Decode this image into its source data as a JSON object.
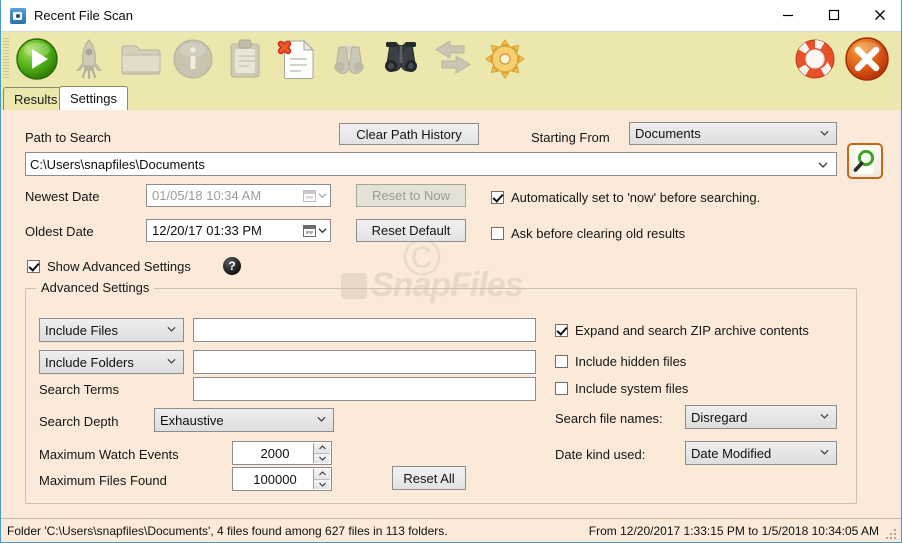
{
  "window": {
    "title": "Recent File Scan",
    "icon": "camera-scan-icon",
    "minimize_label": "—",
    "maximize_label": "□",
    "close_label": "✕"
  },
  "toolbar": {
    "buttons": [
      {
        "name": "start-scan-button",
        "icon": "green-play-icon",
        "enabled": true
      },
      {
        "name": "launch-button",
        "icon": "rocket-icon",
        "enabled": false
      },
      {
        "name": "open-folder-button",
        "icon": "folder-icon",
        "enabled": false
      },
      {
        "name": "info-button",
        "icon": "info-circle-icon",
        "enabled": false
      },
      {
        "name": "clipboard-button",
        "icon": "clipboard-icon",
        "enabled": false
      },
      {
        "name": "clear-results-button",
        "icon": "document-delete-icon",
        "enabled": true
      },
      {
        "name": "find-disabled-button",
        "icon": "binoculars-grey-icon",
        "enabled": false
      },
      {
        "name": "find-button",
        "icon": "binoculars-icon",
        "enabled": true
      },
      {
        "name": "swap-button",
        "icon": "arrows-swap-icon",
        "enabled": false
      },
      {
        "name": "options-button",
        "icon": "gear-icon",
        "enabled": true
      },
      {
        "name": "help-button",
        "icon": "lifebuoy-icon",
        "enabled": true
      },
      {
        "name": "exit-button",
        "icon": "close-circle-icon",
        "enabled": true
      }
    ]
  },
  "tabs": [
    {
      "label": "Results",
      "active": false
    },
    {
      "label": "Settings",
      "active": true
    }
  ],
  "settings": {
    "path_to_search_label": "Path to Search",
    "clear_path_history_label": "Clear Path History",
    "starting_from_label": "Starting From",
    "starting_from_value": "Documents",
    "path_value": "C:\\Users\\snapfiles\\Documents",
    "search_button_icon": "magnifier-search-icon",
    "newest_date_label": "Newest Date",
    "newest_date_value": "01/05/18 10:34 AM",
    "reset_to_now_label": "Reset to Now",
    "oldest_date_label": "Oldest Date",
    "oldest_date_value": "12/20/17 01:33 PM",
    "reset_default_label": "Reset Default",
    "auto_now_label": "Automatically set to 'now' before searching.",
    "auto_now_checked": true,
    "ask_before_clearing_label": "Ask before clearing old results",
    "ask_before_clearing_checked": false,
    "show_advanced_label": "Show Advanced Settings",
    "show_advanced_checked": true,
    "help_glyph": "?"
  },
  "advanced": {
    "group_title": "Advanced Settings",
    "include_files_mode": "Include Files",
    "include_files_value": "",
    "include_folders_mode": "Include Folders",
    "include_folders_value": "",
    "search_terms_label": "Search Terms",
    "search_terms_value": "",
    "search_depth_label": "Search Depth",
    "search_depth_value": "Exhaustive",
    "max_watch_events_label": "Maximum Watch Events",
    "max_watch_events_value": "2000",
    "max_files_found_label": "Maximum Files Found",
    "max_files_found_value": "100000",
    "reset_all_label": "Reset All",
    "expand_zip_label": "Expand and search ZIP archive contents",
    "expand_zip_checked": true,
    "include_hidden_label": "Include hidden files",
    "include_hidden_checked": false,
    "include_system_label": "Include system files",
    "include_system_checked": false,
    "search_file_names_label": "Search file names:",
    "search_file_names_value": "Disregard",
    "date_kind_label": "Date kind used:",
    "date_kind_value": "Date Modified"
  },
  "watermark": {
    "text": "SnapFiles",
    "mark": "©"
  },
  "statusbar": {
    "left": "Folder 'C:\\Users\\snapfiles\\Documents', 4 files found among 627 files in 113 folders.",
    "right": "From 12/20/2017 1:33:15 PM to 1/5/2018 10:34:05 AM"
  },
  "colors": {
    "toolbar_bg": "#ece7ad",
    "form_bg": "#fbeada",
    "accent_border": "#4a9bc4",
    "search_btn_border": "#c8651c"
  }
}
